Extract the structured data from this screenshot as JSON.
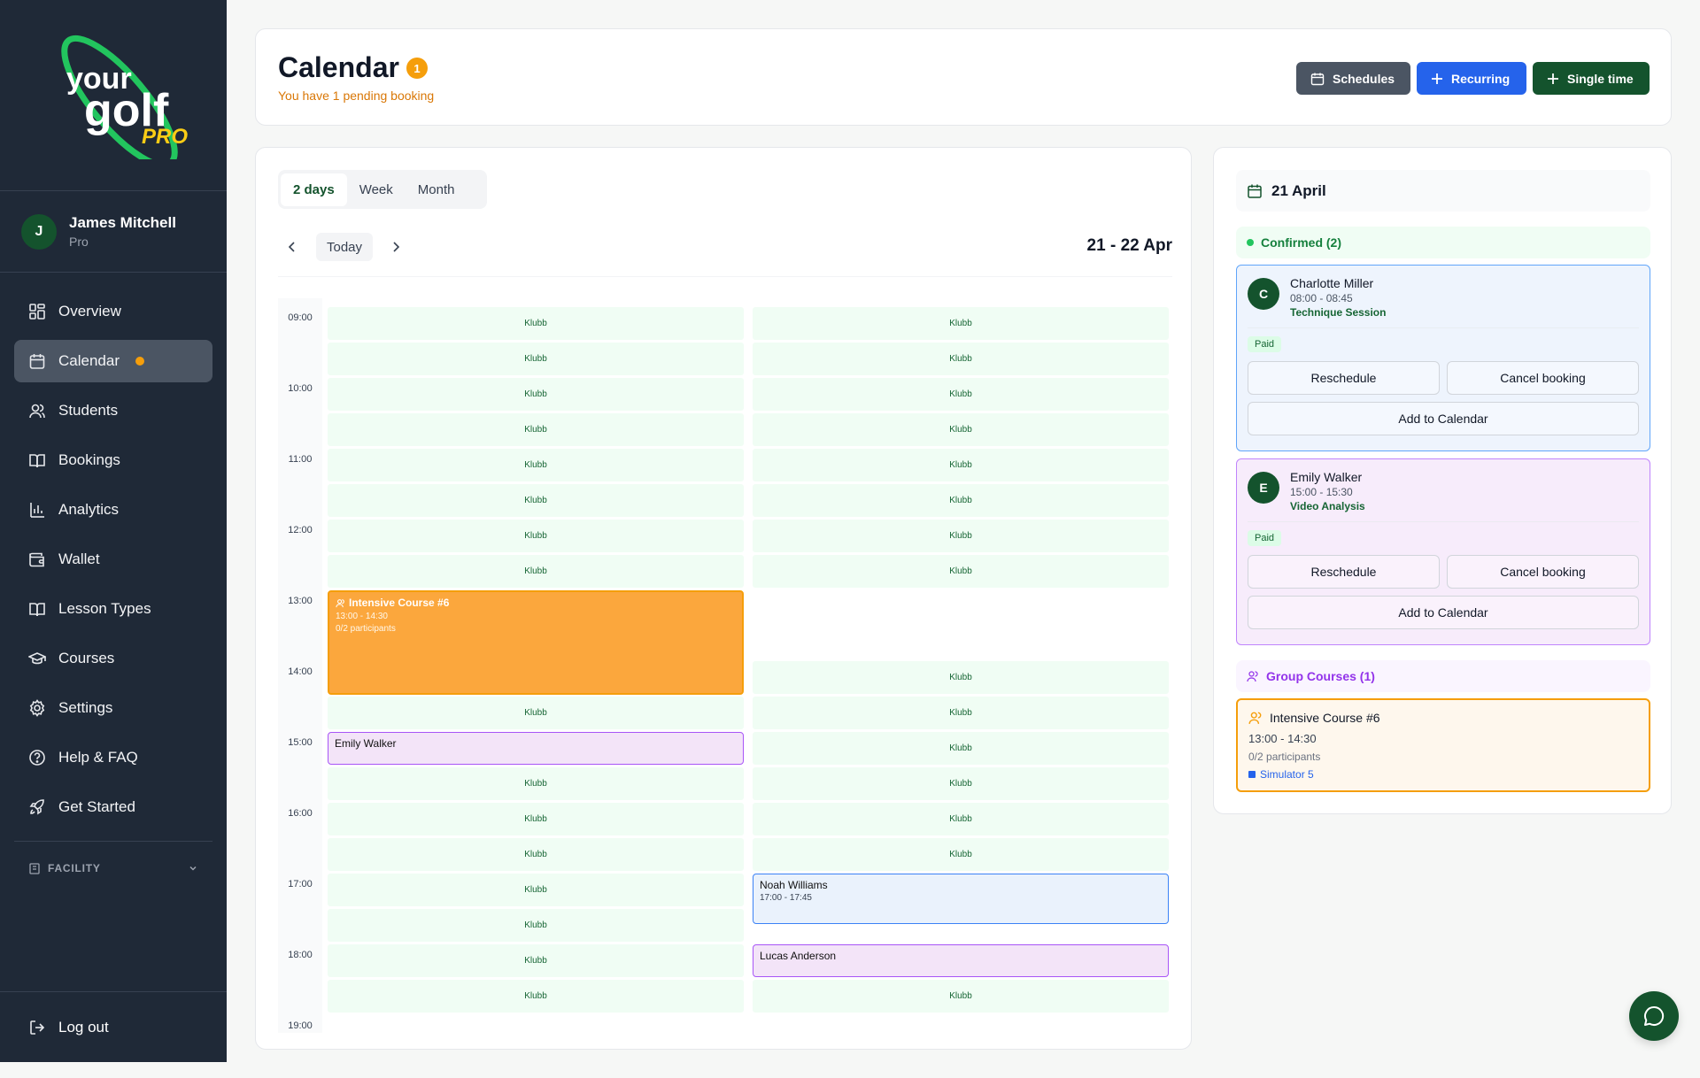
{
  "brand": {
    "logo_text_top": "your",
    "logo_text_mid": "golf",
    "logo_text_pro": "PRO",
    "primary": "#14532d",
    "accent": "#f59e0b"
  },
  "user": {
    "initial": "J",
    "name": "James Mitchell",
    "role": "Pro"
  },
  "nav": [
    {
      "label": "Overview",
      "icon": "grid-icon"
    },
    {
      "label": "Calendar",
      "icon": "calendar-icon"
    },
    {
      "label": "Students",
      "icon": "users-icon"
    },
    {
      "label": "Bookings",
      "icon": "book-icon"
    },
    {
      "label": "Analytics",
      "icon": "bar-chart-icon"
    },
    {
      "label": "Wallet",
      "icon": "wallet-icon"
    },
    {
      "label": "Lesson Types",
      "icon": "book-open-icon"
    },
    {
      "label": "Courses",
      "icon": "graduation-cap-icon"
    },
    {
      "label": "Settings",
      "icon": "gear-icon"
    },
    {
      "label": "Help & FAQ",
      "icon": "help-circle-icon"
    },
    {
      "label": "Get Started",
      "icon": "rocket-icon"
    }
  ],
  "facility_label": "FACILITY",
  "logout_label": "Log out",
  "header": {
    "title": "Calendar",
    "pending_count": "1",
    "pending_text": "You have 1 pending booking",
    "btn_schedules": "Schedules",
    "btn_recurring": "Recurring",
    "btn_single": "Single time"
  },
  "calendar": {
    "view_tabs": [
      "2 days",
      "Week",
      "Month"
    ],
    "active_view": "2 days",
    "today_label": "Today",
    "range_label": "21 - 22 Apr",
    "hours": [
      "09:00",
      "10:00",
      "11:00",
      "12:00",
      "13:00",
      "14:00",
      "15:00",
      "16:00",
      "17:00",
      "18:00",
      "19:00"
    ],
    "slot_label": "Klubb",
    "day1_events": {
      "course": {
        "title": "Intensive Course #6",
        "time": "13:00 - 14:30",
        "participants": "0/2 participants"
      },
      "lesson": {
        "name": "Emily Walker"
      }
    },
    "day2_events": {
      "lesson1": {
        "name": "Noah Williams",
        "time": "17:00 - 17:45"
      },
      "lesson2": {
        "name": "Lucas Anderson"
      }
    }
  },
  "panel": {
    "date": "21 April",
    "confirmed_label": "Confirmed (2)",
    "bookings": [
      {
        "initial": "C",
        "name": "Charlotte Miller",
        "time": "08:00 - 08:45",
        "type": "Technique Session",
        "status": "Paid"
      },
      {
        "initial": "E",
        "name": "Emily Walker",
        "time": "15:00 - 15:30",
        "type": "Video Analysis",
        "status": "Paid"
      }
    ],
    "btn_reschedule": "Reschedule",
    "btn_cancel": "Cancel booking",
    "btn_add_calendar": "Add to Calendar",
    "group_label": "Group Courses (1)",
    "group": {
      "title": "Intensive Course #6",
      "time": "13:00 - 14:30",
      "participants": "0/2 participants",
      "location": "Simulator 5"
    }
  }
}
